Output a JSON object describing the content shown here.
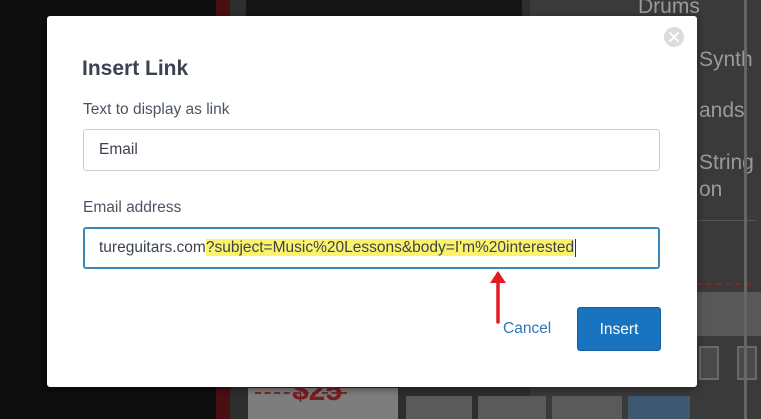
{
  "background": {
    "categories": [
      {
        "id": "drums",
        "label": "Drums"
      },
      {
        "id": "synth",
        "label": "Synth"
      },
      {
        "id": "ands",
        "label": "ands"
      },
      {
        "id": "string",
        "label": "String"
      },
      {
        "id": "on",
        "label": "on"
      }
    ],
    "price_fragment": "$25"
  },
  "dialog": {
    "title": "Insert Link",
    "close_icon": "close-icon",
    "display_text": {
      "label": "Text to display as link",
      "value": "Email"
    },
    "email_address": {
      "label": "Email address",
      "value_plain": "tureguitars.com",
      "value_highlighted": "?subject=Music%20Lessons&body=I'm%20interested"
    },
    "cancel_label": "Cancel",
    "insert_label": "Insert"
  },
  "annotation": {
    "arrow_icon": "red-arrow-icon",
    "arrow_color": "#e21b23",
    "highlight_color": "#fcf36b"
  },
  "colors": {
    "accent": "#1a73bf",
    "focus_border": "#3d86b8",
    "link": "#2c77b9"
  }
}
